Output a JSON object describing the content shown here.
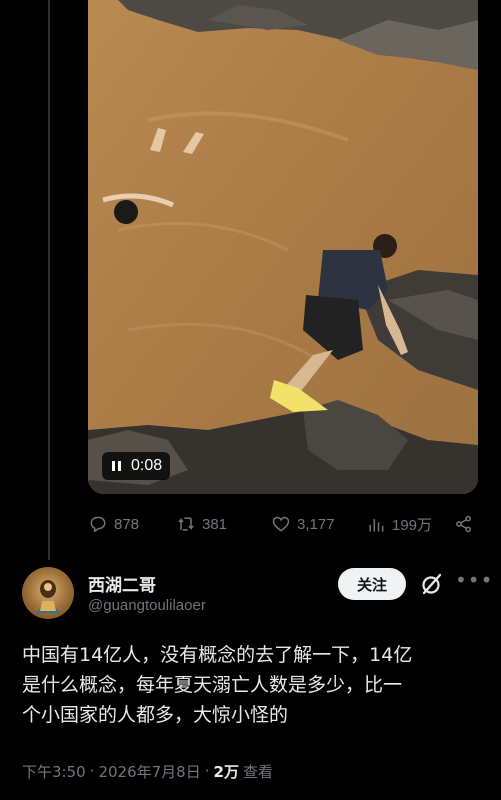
{
  "video": {
    "timestamp": "0:08",
    "state": "playing"
  },
  "actions": {
    "replies": "878",
    "retweets": "381",
    "likes": "3,177",
    "views": "199万"
  },
  "author": {
    "display_name": "西湖二哥",
    "handle": "@guangtoulilaoer",
    "follow_label": "关注"
  },
  "tweet": {
    "lines": [
      "中国有14亿人，没有概念的去了解一下，14亿",
      "是什么概念，每年夏天溺亡人数是多少，比一",
      "个小国家的人都多，大惊小怪的"
    ]
  },
  "meta": {
    "time": "下午3:50",
    "sep1": "·",
    "date": "2026年7月8日",
    "sep2": "·",
    "views": "2万",
    "views_label": "查看"
  },
  "colors": {
    "background": "#000000",
    "text_primary": "#e7e9ea",
    "text_secondary": "#71767b",
    "follow_bg": "#eff3f4",
    "river": "#b0834e"
  },
  "icons": [
    "reply-icon",
    "retweet-icon",
    "like-icon",
    "views-icon",
    "share-icon",
    "grok-icon",
    "more-icon",
    "pause-icon"
  ]
}
